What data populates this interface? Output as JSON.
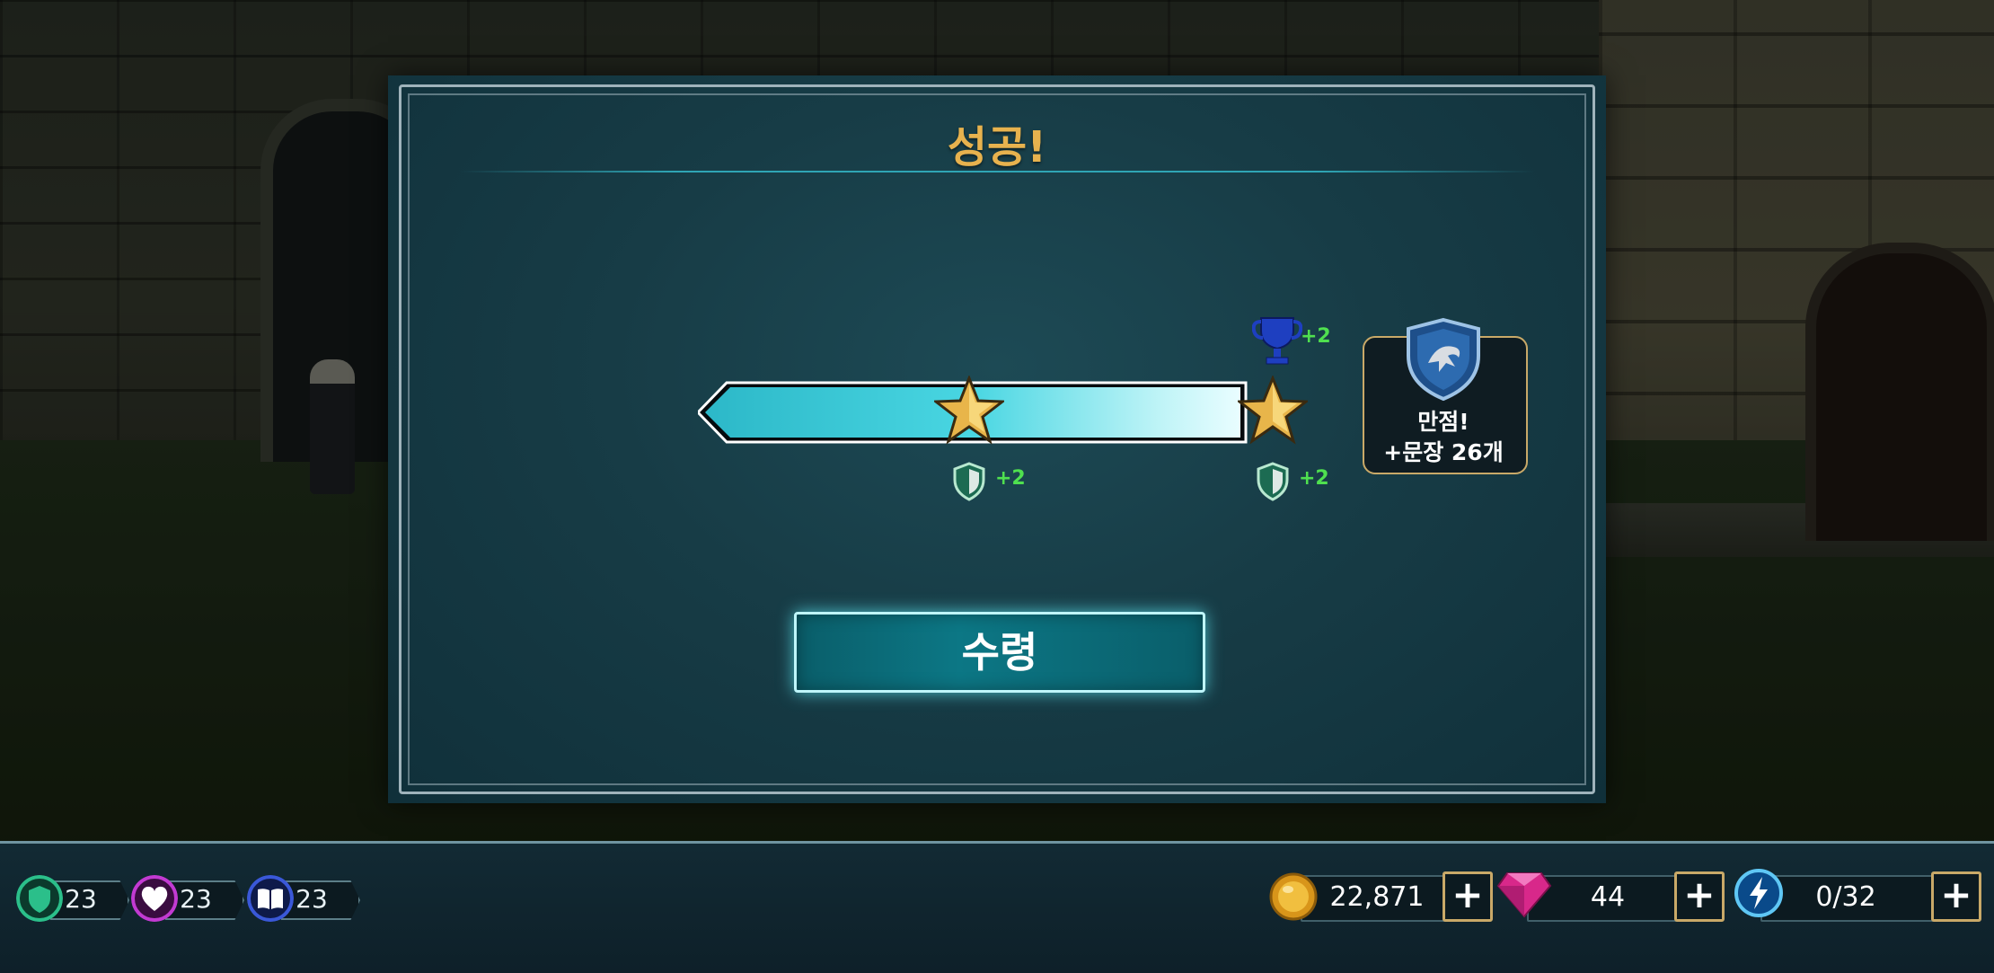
{
  "dialog": {
    "title": "성공!",
    "milestones": [
      {
        "reward_icon": "shield-icon",
        "reward_text": "+2"
      },
      {
        "reward_icon": "shield-icon",
        "reward_text": "+2"
      }
    ],
    "bonus": {
      "icon": "trophy-icon",
      "text": "+2"
    },
    "full_score": {
      "icon": "ravenclaw-crest-icon",
      "line1": "만점!",
      "line2": "+문장 26개"
    },
    "progress": 1.0,
    "stars_earned": 2,
    "claim_button": "수령"
  },
  "hud": {
    "stats": [
      {
        "icon": "shield-stat-icon",
        "value": "23",
        "color": "#2bbf8a"
      },
      {
        "icon": "heart-stat-icon",
        "value": "23",
        "color": "#c23ad2"
      },
      {
        "icon": "book-stat-icon",
        "value": "23",
        "color": "#3a58d8"
      }
    ],
    "coins": "22,871",
    "gems": "44",
    "energy": "0/32"
  },
  "colors": {
    "title": "#e7b24e",
    "reward_green": "#4fe04f",
    "bar_fill": "#3fd0df",
    "button_glow": "#5ee9f5"
  }
}
